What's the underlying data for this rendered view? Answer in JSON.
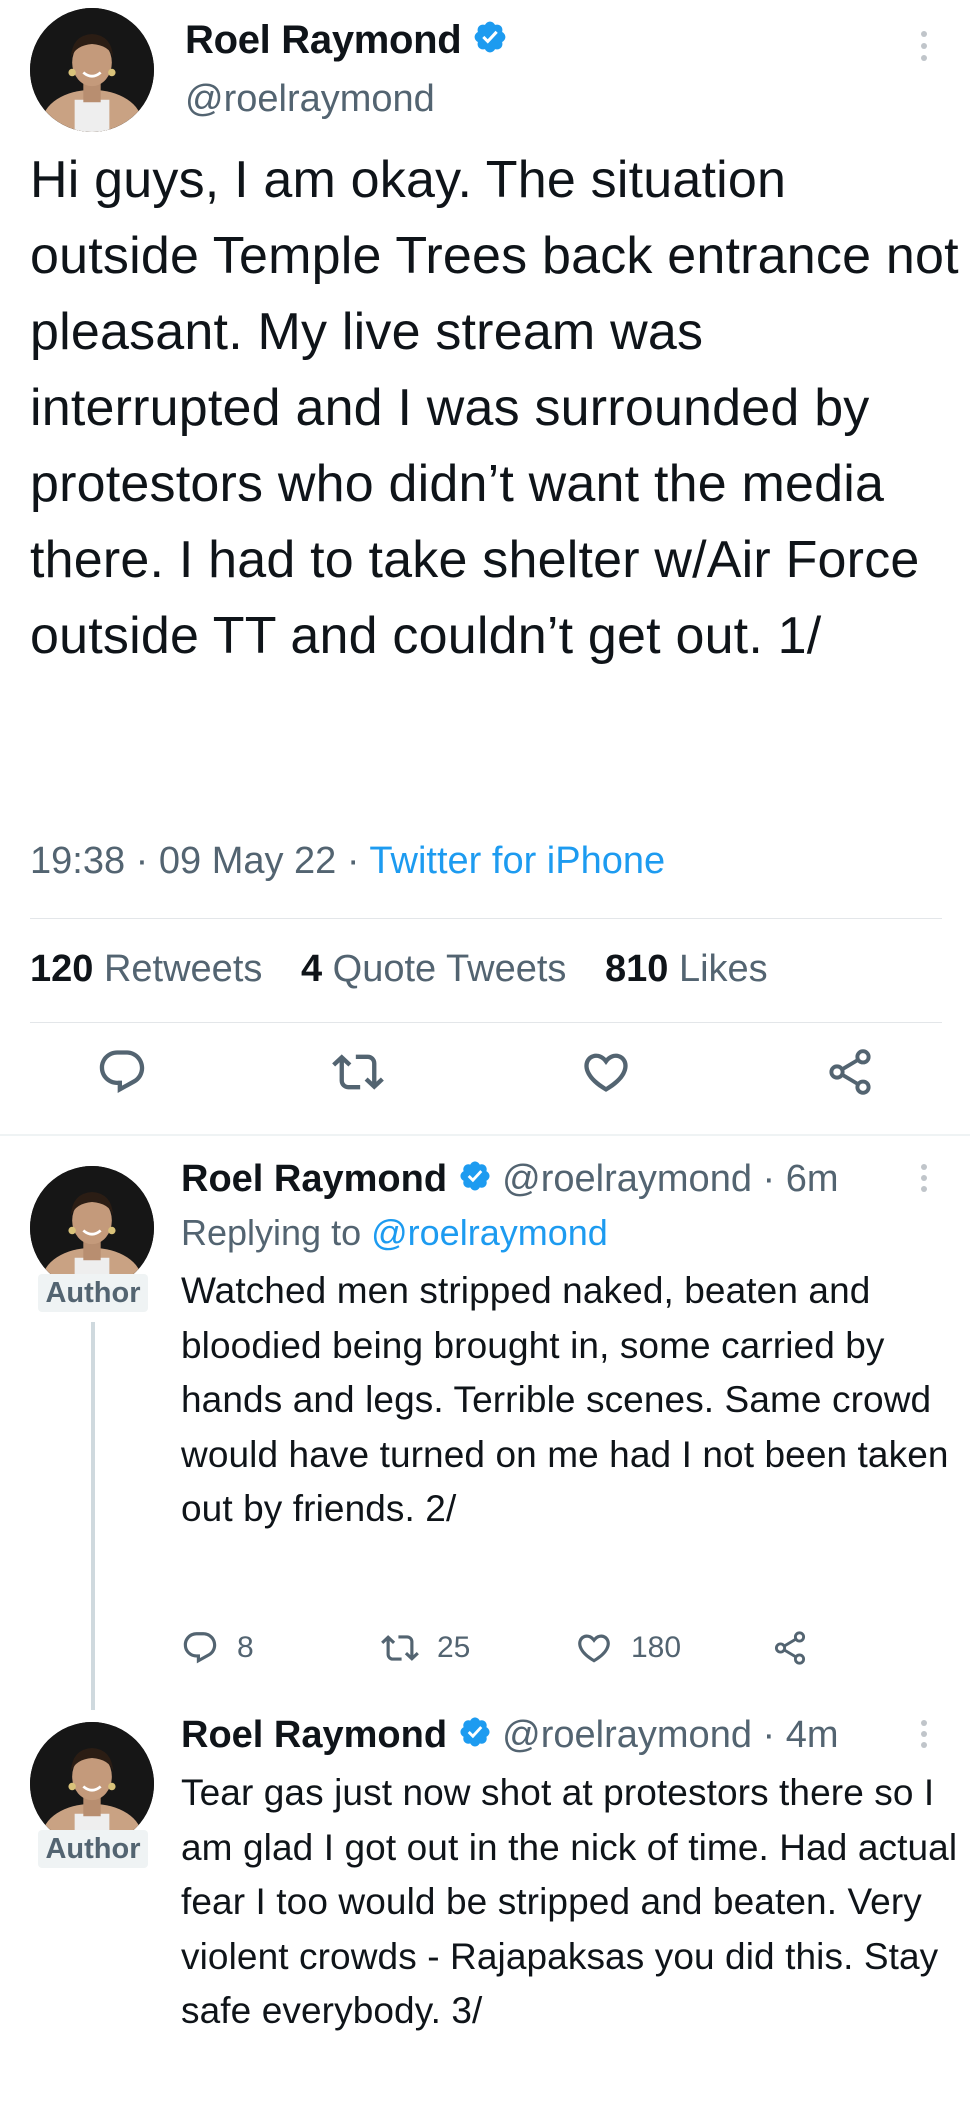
{
  "main_tweet": {
    "author_name": "Roel Raymond",
    "author_handle": "@roelraymond",
    "text": "Hi guys, I am okay. The situation outside Temple Trees back entrance not pleasant. My live stream was interrupted and I was surrounded by protestors who didn’t want the media there. I had to take shelter w/Air Force outside TT and couldn’t get out. 1/",
    "time": "19:38",
    "date": "09 May 22",
    "source": "Twitter for iPhone",
    "separator": "·",
    "stats": {
      "retweets_count": "120",
      "retweets_label": "Retweets",
      "quotes_count": "4",
      "quotes_label": "Quote Tweets",
      "likes_count": "810",
      "likes_label": "Likes"
    },
    "actions": [
      "reply-icon",
      "retweet-icon",
      "like-icon",
      "share-icon"
    ]
  },
  "replies": [
    {
      "author_name": "Roel Raymond",
      "author_handle": "@roelraymond",
      "separator": "·",
      "time_ago": "6m",
      "badge": "Author",
      "replying_prefix": "Replying to",
      "replying_to": "@roelraymond",
      "text": "Watched men stripped naked,  beaten and bloodied being brought in, some carried by hands and legs. Terrible scenes. Same crowd would have turned on me had I not been taken out by friends. 2/",
      "reply_count": "8",
      "retweet_count": "25",
      "like_count": "180"
    },
    {
      "author_name": "Roel Raymond",
      "author_handle": "@roelraymond",
      "separator": "·",
      "time_ago": "4m",
      "badge": "Author",
      "text": "Tear gas just now shot at protestors there so I am glad I got out in the nick of time. Had actual fear I too would be stripped and beaten. Very violent crowds - Rajapaksas you did this. Stay safe everybody. 3/"
    }
  ],
  "colors": {
    "verified": "#1d9bf0",
    "link": "#1d9bf0",
    "secondary_text": "#536471",
    "primary_text": "#0f1419"
  }
}
